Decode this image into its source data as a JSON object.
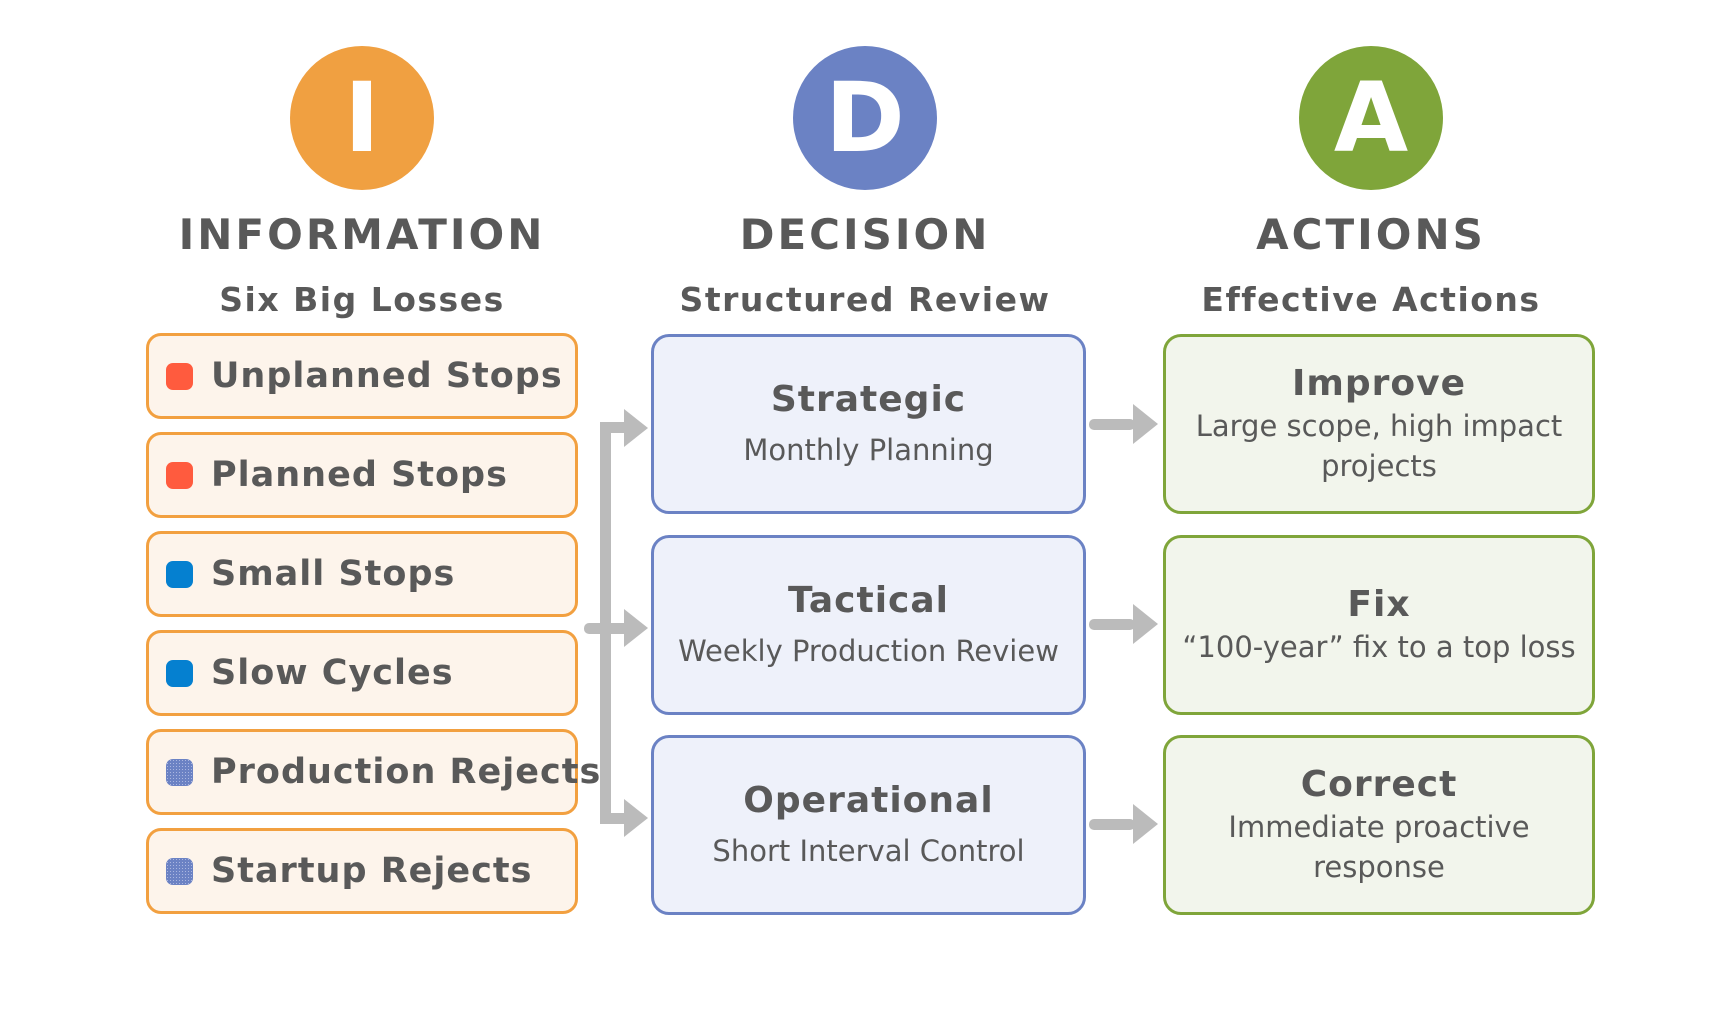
{
  "columns": [
    {
      "letter": "I",
      "heading": "INFORMATION",
      "subtitle": "Six Big Losses",
      "color": "#F0A041"
    },
    {
      "letter": "D",
      "heading": "DECISION",
      "subtitle": "Structured Review",
      "color": "#6B82C4"
    },
    {
      "letter": "A",
      "heading": "ACTIONS",
      "subtitle": "Effective Actions",
      "color": "#7FA53A"
    }
  ],
  "losses": [
    {
      "label": "Unplanned Stops",
      "marker": "red-square",
      "color": "#FF5B3E"
    },
    {
      "label": "Planned Stops",
      "marker": "red-square",
      "color": "#FF5B3E"
    },
    {
      "label": "Small Stops",
      "marker": "blue-square",
      "color": "#0580D0"
    },
    {
      "label": "Slow Cycles",
      "marker": "blue-square",
      "color": "#0580D0"
    },
    {
      "label": "Production Rejects",
      "marker": "dotted-blue-square",
      "color": "#6B82C4"
    },
    {
      "label": "Startup Rejects",
      "marker": "dotted-blue-square",
      "color": "#6B82C4"
    }
  ],
  "decisions": [
    {
      "title": "Strategic",
      "desc": "Monthly Planning"
    },
    {
      "title": "Tactical",
      "desc": "Weekly Production Review"
    },
    {
      "title": "Operational",
      "desc": "Short Interval Control"
    }
  ],
  "actions": [
    {
      "title": "Improve",
      "desc": "Large scope, high impact projects"
    },
    {
      "title": "Fix",
      "desc": "“100-year” fix to a top loss"
    },
    {
      "title": "Correct",
      "desc": "Immediate proactive response"
    }
  ],
  "colors": {
    "arrow": "#BBBBBB",
    "text": "#595959"
  }
}
